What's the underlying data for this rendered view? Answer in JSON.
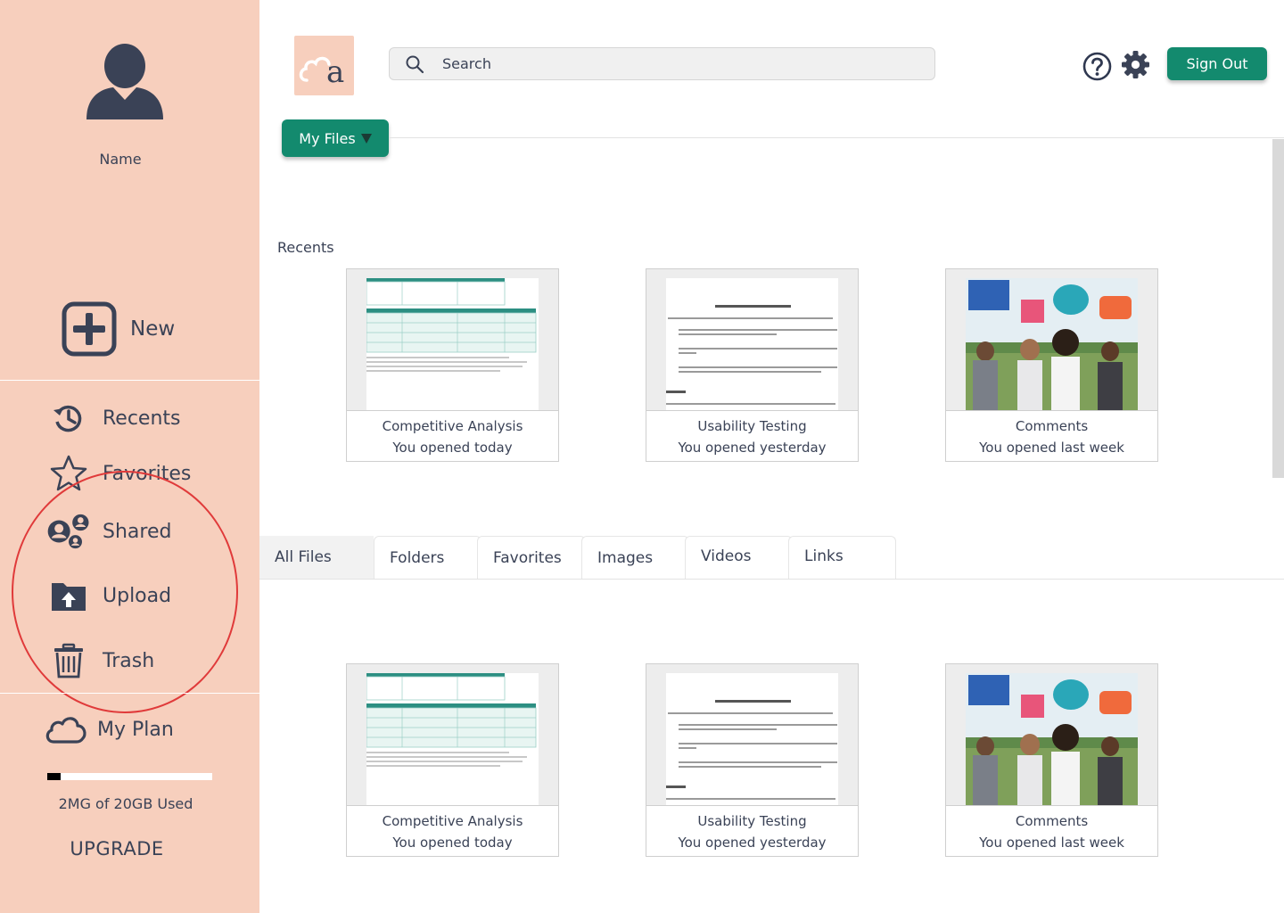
{
  "sidebar": {
    "user_name": "Name",
    "new_label": "New",
    "items": [
      {
        "label": "Recents",
        "icon": "history-icon"
      },
      {
        "label": "Favorites",
        "icon": "star-icon"
      },
      {
        "label": "Shared",
        "icon": "shared-users-icon"
      },
      {
        "label": "Upload",
        "icon": "upload-folder-icon"
      },
      {
        "label": "Trash",
        "icon": "trash-icon"
      }
    ],
    "plan_label": "My Plan",
    "storage_used_fraction": 0.08,
    "storage_text": "2MG of 20GB Used",
    "upgrade_label": "UPGRADE"
  },
  "header": {
    "logo_letter": "a",
    "search_placeholder": "Search",
    "signout_label": "Sign Out",
    "myfiles_label": "My Files"
  },
  "recents": {
    "title": "Recents",
    "cards": [
      {
        "name": "Competitive Analysis",
        "when": "You opened today",
        "thumb": "spreadsheet"
      },
      {
        "name": "Usability Testing",
        "when": "You opened yesterday",
        "thumb": "document"
      },
      {
        "name": "Comments",
        "when": "You opened last week",
        "thumb": "photo"
      }
    ]
  },
  "tabs": [
    {
      "label": "All Files",
      "active": true
    },
    {
      "label": "Folders",
      "active": false
    },
    {
      "label": "Favorites",
      "active": false
    },
    {
      "label": "Images",
      "active": false
    },
    {
      "label": "Videos",
      "active": false
    },
    {
      "label": "Links",
      "active": false
    }
  ],
  "files": {
    "cards": [
      {
        "name": "Competitive Analysis",
        "when": "You opened today",
        "thumb": "spreadsheet"
      },
      {
        "name": "Usability Testing",
        "when": "You opened yesterday",
        "thumb": "document"
      },
      {
        "name": "Comments",
        "when": "You opened last week",
        "thumb": "photo"
      }
    ]
  },
  "colors": {
    "sidebar_bg": "#f7cfbd",
    "accent": "#138a6e",
    "text": "#3a4256",
    "annotation": "#e03a3a"
  }
}
